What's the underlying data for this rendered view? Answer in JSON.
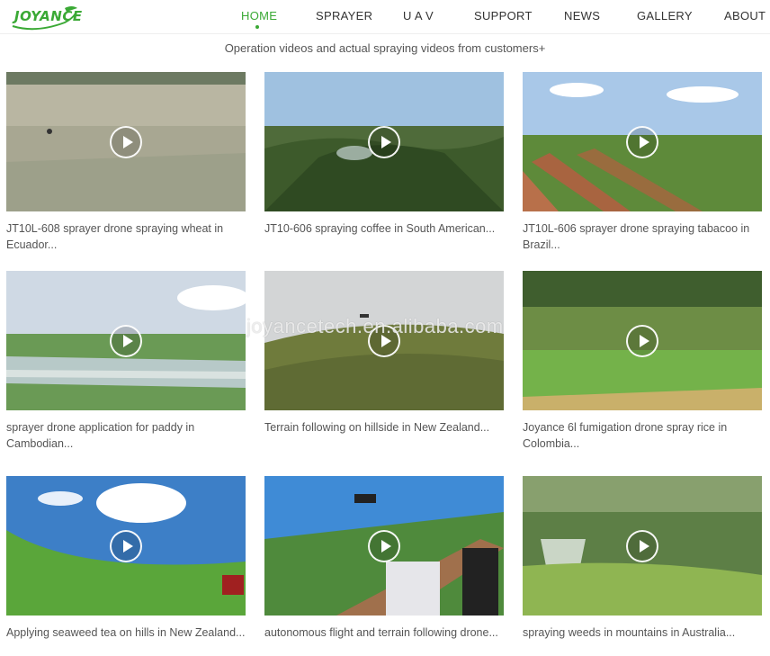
{
  "header": {
    "logo_text": "JOYANCE",
    "nav": [
      {
        "label": "HOME",
        "active": true
      },
      {
        "label": "SPRAYER",
        "active": false
      },
      {
        "label": "U A V",
        "active": false
      },
      {
        "label": "SUPPORT",
        "active": false
      },
      {
        "label": "NEWS",
        "active": false
      },
      {
        "label": "GALLERY",
        "active": false
      },
      {
        "label": "ABOUT",
        "active": false
      }
    ]
  },
  "section": {
    "subtitle": "Operation videos and actual spraying videos from customers+"
  },
  "videos": [
    {
      "caption": "JT10L-608 sprayer drone spraying wheat in Ecuador..."
    },
    {
      "caption": "JT10-606 spraying coffee in South American..."
    },
    {
      "caption": "JT10L-606 sprayer drone spraying tabacoo in Brazil..."
    },
    {
      "caption": "sprayer drone application for paddy in Cambodian..."
    },
    {
      "caption": "Terrain following on hillside in New Zealand..."
    },
    {
      "caption": "Joyance 6l fumigation drone spray rice in Colombia..."
    },
    {
      "caption": "Applying seaweed tea on hills in New Zealand..."
    },
    {
      "caption": "autonomous flight and terrain following drone..."
    },
    {
      "caption": "spraying weeds in mountains in Australia..."
    }
  ],
  "watermark": "joyancetech.en.alibaba.com",
  "colors": {
    "accent": "#3aa935"
  }
}
